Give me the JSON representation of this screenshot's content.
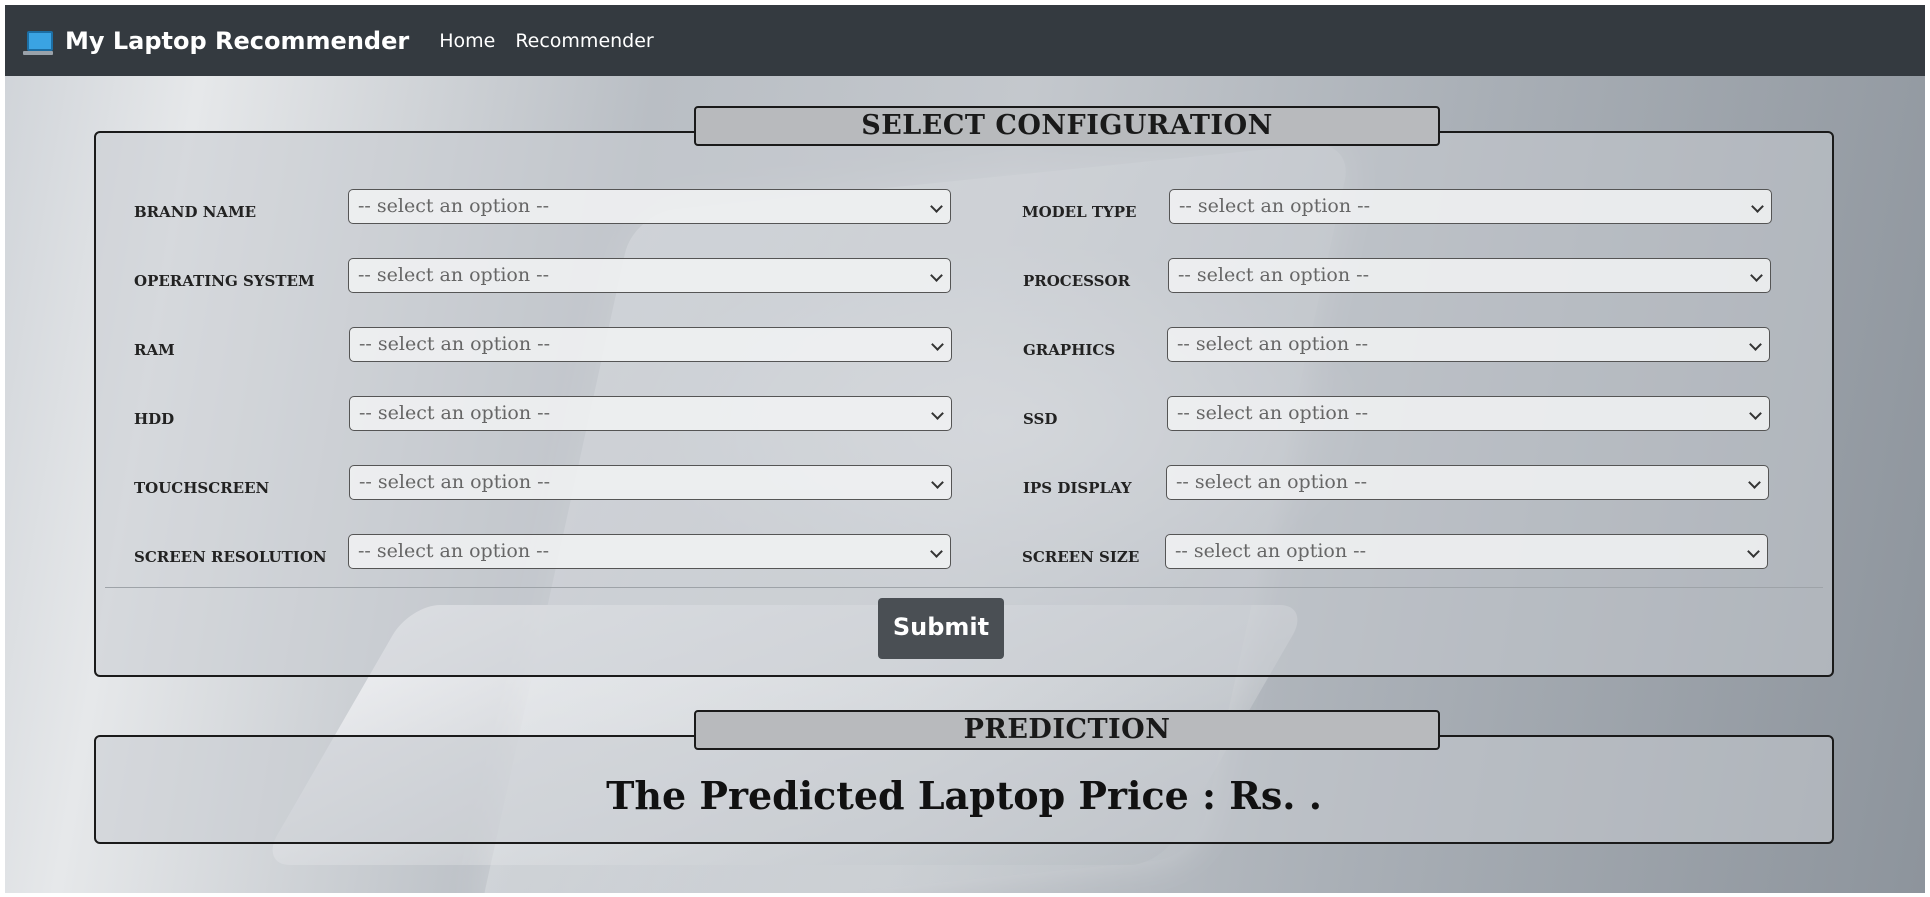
{
  "nav": {
    "brand": "My Laptop Recommender",
    "links": [
      "Home",
      "Recommender"
    ]
  },
  "config": {
    "legend": "SELECT CONFIGURATION",
    "placeholder": "-- select an option --",
    "fields": [
      "BRAND NAME",
      "MODEL TYPE",
      "OPERATING SYSTEM",
      "PROCESSOR",
      "RAM",
      "GRAPHICS",
      "HDD",
      "SSD",
      "TOUCHSCREEN",
      "IPS DISPLAY",
      "SCREEN RESOLUTION",
      "SCREEN SIZE"
    ],
    "submit_label": "Submit"
  },
  "prediction": {
    "legend": "PREDICTION",
    "text": "The Predicted Laptop Price : Rs. ."
  },
  "colors": {
    "navbar": "#343a40",
    "button": "#4a4f54"
  },
  "icons": {
    "brand": "laptop-icon",
    "dropdown": "chevron-down-icon"
  }
}
